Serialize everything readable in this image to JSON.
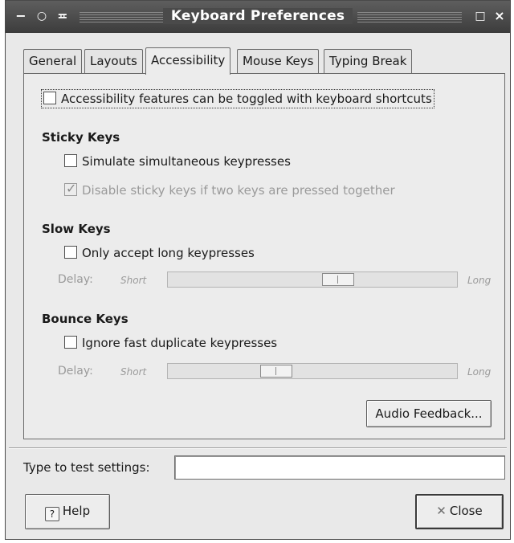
{
  "window": {
    "title": "Keyboard Preferences"
  },
  "titlebar": {
    "menu_glyph": "−",
    "sticky_glyph": "○",
    "shade_glyph": "≖",
    "max_glyph": "□",
    "close_glyph": "×"
  },
  "tabs": [
    {
      "label": "General",
      "active": false
    },
    {
      "label": "Layouts",
      "active": false
    },
    {
      "label": "Accessibility",
      "active": true
    },
    {
      "label": "Mouse Keys",
      "active": false
    },
    {
      "label": "Typing Break",
      "active": false
    }
  ],
  "accessibility": {
    "toggle_shortcuts": {
      "label": "Accessibility features can be toggled with keyboard shortcuts",
      "checked": false
    }
  },
  "sticky_keys": {
    "heading": "Sticky Keys",
    "simulate": {
      "label": "Simulate simultaneous keypresses",
      "checked": false
    },
    "disable_two_keys": {
      "label": "Disable sticky keys if two keys are pressed together",
      "checked": true,
      "enabled": false
    }
  },
  "slow_keys": {
    "heading": "Slow Keys",
    "only_long": {
      "label": "Only accept long keypresses",
      "checked": false
    },
    "delay": {
      "label": "Delay:",
      "min_label": "Short",
      "max_label": "Long",
      "level": 0.6
    }
  },
  "bounce_keys": {
    "heading": "Bounce Keys",
    "ignore_fast": {
      "label": "Ignore fast duplicate keypresses",
      "checked": false
    },
    "delay": {
      "label": "Delay:",
      "min_label": "Short",
      "max_label": "Long",
      "level": 0.36
    }
  },
  "audio_feedback_button": "Audio Feedback...",
  "test": {
    "label": "Type to test settings:",
    "value": ""
  },
  "help_button": {
    "label": "Help",
    "icon": "help-icon"
  },
  "close_button": {
    "label": "Close",
    "icon": "close-x-icon"
  }
}
